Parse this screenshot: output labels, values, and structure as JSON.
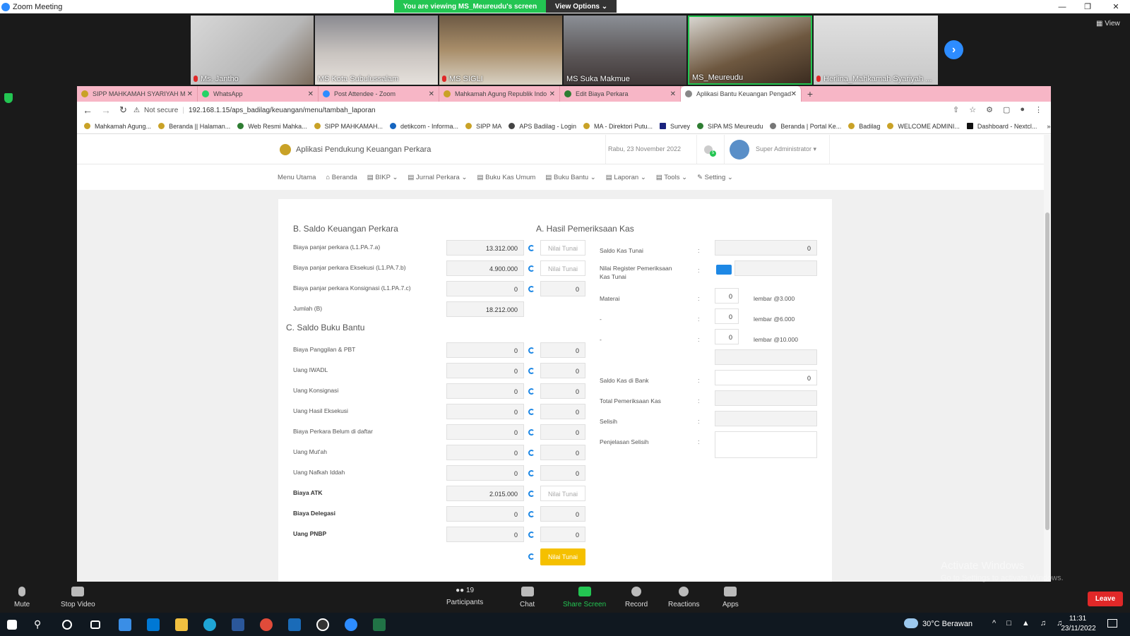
{
  "zoom": {
    "window_title": "Zoom Meeting",
    "viewing_banner": "You are viewing MS_Meureudu's screen",
    "view_options": "View Options ⌄",
    "view_label": "View",
    "participants": [
      "Ms. Jantho",
      "MS Kota Subulussalam",
      "MS SIGLI",
      "MS Suka Makmue",
      "MS_Meureudu",
      "Herlina_Mahkamah Syariyah ..."
    ],
    "toolbar": {
      "mute": "Mute",
      "stop_video": "Stop Video",
      "participants": "Participants",
      "participants_count": "19",
      "chat": "Chat",
      "share_screen": "Share Screen",
      "record": "Record",
      "reactions": "Reactions",
      "apps": "Apps",
      "leave": "Leave"
    },
    "activate_title": "Activate Windows",
    "activate_sub": "Go to Settings to activate Windows."
  },
  "browser": {
    "tabs": [
      {
        "label": "SIPP MAHKAMAH SYARIYAH M",
        "color": "#c9a227"
      },
      {
        "label": "WhatsApp",
        "color": "#25d366"
      },
      {
        "label": "Post Attendee - Zoom",
        "color": "#2d8cff"
      },
      {
        "label": "Mahkamah Agung Republik Indo",
        "color": "#c9a227"
      },
      {
        "label": "Edit Biaya Perkara",
        "color": "#2e7d32"
      },
      {
        "label": "Aplikasi Bantu Keuangan Pengad",
        "color": "#888888"
      }
    ],
    "not_secure": "Not secure",
    "url": "192.168.1.15/aps_badilag/keuangan/menu/tambah_laporan",
    "bookmarks": [
      "Mahkamah Agung...",
      "Beranda || Halaman...",
      "Web Resmi Mahka...",
      "SIPP MAHKAMAH...",
      "detikcom - Informa...",
      "SIPP MA",
      "APS Badilag - Login",
      "MA - Direktori Putu...",
      "Survey",
      "SIPA MS Meureudu",
      "Beranda | Portal Ke...",
      "Badilag",
      "WELCOME ADMINI...",
      "Dashboard - Nextcl..."
    ]
  },
  "app": {
    "title": "Aplikasi Pendukung Keuangan Perkara",
    "date": "Rabu, 23 November 2022",
    "notif_count": "5",
    "user": "Super Administrator",
    "menu": [
      "Menu Utama",
      "Beranda",
      "BIKP",
      "Jurnal Perkara",
      "Buku Kas Umum",
      "Buku Bantu",
      "Laporan",
      "Tools",
      "Setting"
    ],
    "section_b": "B. Saldo Keuangan Perkara",
    "section_c": "C. Saldo Buku Bantu",
    "section_a": "A. Hasil Pemeriksaan Kas",
    "b_rows": [
      {
        "label": "Biaya panjar perkara (L1.PA.7.a)",
        "value": "13.312.000",
        "second": "Nilai Tunai"
      },
      {
        "label": "Biaya panjar perkara Eksekusi (L1.PA.7.b)",
        "value": "4.900.000",
        "second": "Nilai Tunai"
      },
      {
        "label": "Biaya panjar perkara Konsignasi (L1.PA.7.c)",
        "value": "0",
        "second": "0"
      }
    ],
    "jumlah_label": "Jumlah (B)",
    "jumlah_value": "18.212.000",
    "c_rows": [
      {
        "label": "Biaya Panggilan & PBT",
        "value": "0",
        "second": "0"
      },
      {
        "label": "Uang IWADL",
        "value": "0",
        "second": "0"
      },
      {
        "label": "Uang Konsignasi",
        "value": "0",
        "second": "0"
      },
      {
        "label": "Uang Hasil Eksekusi",
        "value": "0",
        "second": "0"
      },
      {
        "label": "Biaya Perkara Belum di daftar",
        "value": "0",
        "second": "0"
      },
      {
        "label": "Uang Mut'ah",
        "value": "0",
        "second": "0"
      },
      {
        "label": "Uang Nafkah Iddah",
        "value": "0",
        "second": "0"
      },
      {
        "label": "Biaya ATK",
        "value": "2.015.000",
        "second": "Nilai Tunai"
      },
      {
        "label": "Biaya Delegasi",
        "value": "0",
        "second": "0"
      },
      {
        "label": "Uang PNBP",
        "value": "0",
        "second": "0"
      }
    ],
    "yellow_button": "Nilai Tunai",
    "a": {
      "saldo_kas_tunai": "Saldo Kas Tunai",
      "saldo_kas_tunai_value": "0",
      "nilai_register": "Nilai Register Pemeriksaan Kas Tunai",
      "materai": "Materai",
      "dash": "-",
      "colon": ":",
      "materai_rows": [
        {
          "count": "0",
          "label": "lembar @3.000"
        },
        {
          "count": "0",
          "label": "lembar @6.000"
        },
        {
          "count": "0",
          "label": "lembar @10.000"
        }
      ],
      "saldo_bank": "Saldo Kas di Bank",
      "saldo_bank_value": "0",
      "total": "Total Pemeriksaan Kas",
      "selisih": "Selisih",
      "penjelasan": "Penjelasan Selisih"
    }
  },
  "taskbar": {
    "weather": "30°C  Berawan",
    "time": "11:31",
    "date": "23/11/2022"
  }
}
